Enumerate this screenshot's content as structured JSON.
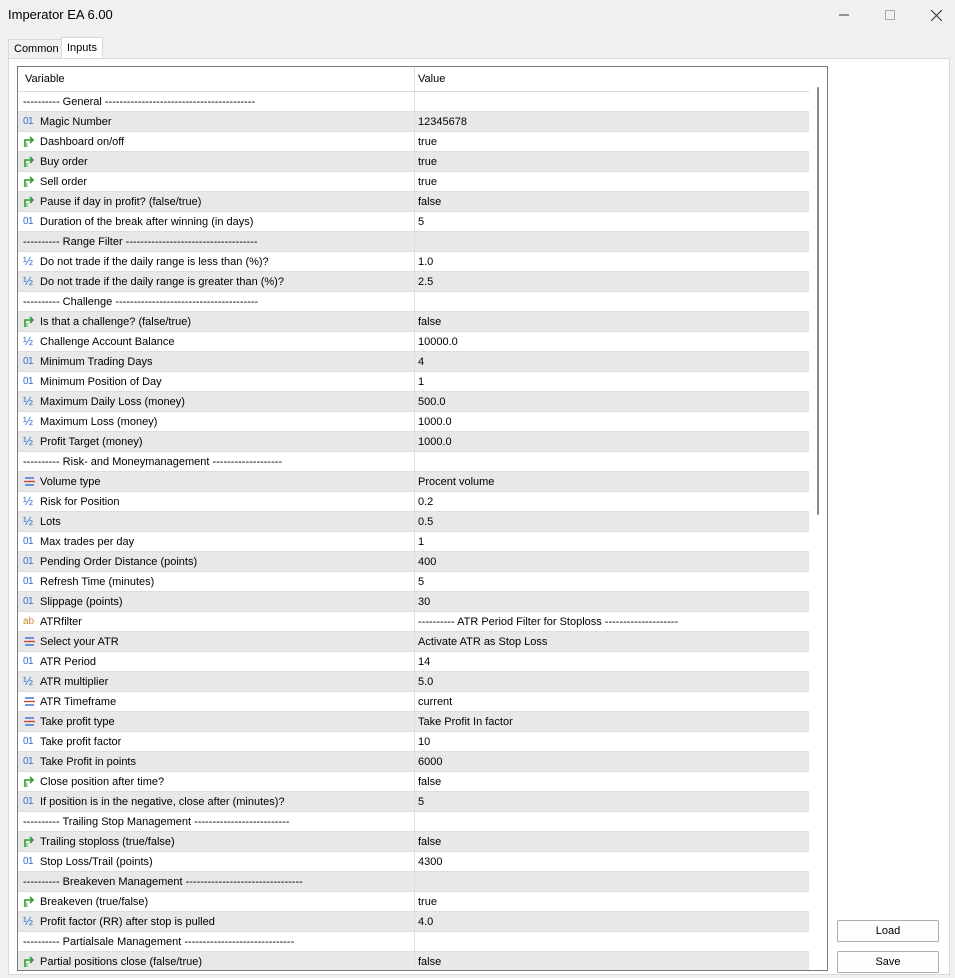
{
  "window": {
    "title": "Imperator EA 6.00"
  },
  "tabs": {
    "common": "Common",
    "inputs": "Inputs"
  },
  "table": {
    "col_variable": "Variable",
    "col_value": "Value"
  },
  "rows": [
    {
      "type": "section",
      "name": "---------- General -----------------------------------------",
      "value": ""
    },
    {
      "type": "int",
      "name": "Magic Number",
      "value": "12345678"
    },
    {
      "type": "bool",
      "name": "Dashboard on/off",
      "value": "true"
    },
    {
      "type": "bool",
      "name": "Buy order",
      "value": "true"
    },
    {
      "type": "bool",
      "name": "Sell order",
      "value": "true"
    },
    {
      "type": "bool",
      "name": "Pause if day in profit? (false/true)",
      "value": "false"
    },
    {
      "type": "int",
      "name": "Duration of the break after winning (in days)",
      "value": "5"
    },
    {
      "type": "section",
      "name": "---------- Range Filter ------------------------------------",
      "value": ""
    },
    {
      "type": "double",
      "name": "Do not trade  if the daily range is less than (%)?",
      "value": "1.0"
    },
    {
      "type": "double",
      "name": "Do not trade if the daily range is greater than (%)?",
      "value": "2.5"
    },
    {
      "type": "section",
      "name": "---------- Challenge ---------------------------------------",
      "value": ""
    },
    {
      "type": "bool",
      "name": "Is that a challenge? (false/true)",
      "value": "false"
    },
    {
      "type": "double",
      "name": "Challenge Account Balance",
      "value": "10000.0"
    },
    {
      "type": "int",
      "name": "Minimum Trading Days",
      "value": "4"
    },
    {
      "type": "int",
      "name": "Minimum Position of Day",
      "value": "1"
    },
    {
      "type": "double",
      "name": "Maximum Daily Loss (money)",
      "value": "500.0"
    },
    {
      "type": "double",
      "name": "Maximum Loss (money)",
      "value": "1000.0"
    },
    {
      "type": "double",
      "name": "Profit Target (money)",
      "value": "1000.0"
    },
    {
      "type": "section",
      "name": "---------- Risk- and Moneymanagement -------------------",
      "value": ""
    },
    {
      "type": "enum",
      "name": "Volume type",
      "value": "Procent volume"
    },
    {
      "type": "double",
      "name": "Risk for Position",
      "value": "0.2"
    },
    {
      "type": "double",
      "name": "Lots",
      "value": "0.5"
    },
    {
      "type": "int",
      "name": "Max trades per day",
      "value": "1"
    },
    {
      "type": "int",
      "name": "Pending Order Distance (points)",
      "value": "400"
    },
    {
      "type": "int",
      "name": "Refresh Time (minutes)",
      "value": "5"
    },
    {
      "type": "int",
      "name": "Slippage (points)",
      "value": "30"
    },
    {
      "type": "string",
      "name": "ATRfilter",
      "value": "---------- ATR Period Filter for Stoploss --------------------"
    },
    {
      "type": "enum",
      "name": "Select your ATR",
      "value": "Activate ATR as Stop Loss"
    },
    {
      "type": "int",
      "name": "ATR Period",
      "value": "14"
    },
    {
      "type": "double",
      "name": "ATR multiplier",
      "value": "5.0"
    },
    {
      "type": "enum",
      "name": "ATR Timeframe",
      "value": "current"
    },
    {
      "type": "enum",
      "name": "Take profit type",
      "value": "Take Profit In factor"
    },
    {
      "type": "int",
      "name": "Take profit factor",
      "value": "10"
    },
    {
      "type": "int",
      "name": "Take Profit in points",
      "value": "6000"
    },
    {
      "type": "bool",
      "name": "Close position after time?",
      "value": "false"
    },
    {
      "type": "int",
      "name": "If position is in the negative, close after (minutes)?",
      "value": "5"
    },
    {
      "type": "section",
      "name": "---------- Trailing Stop Management --------------------------",
      "value": ""
    },
    {
      "type": "bool",
      "name": "Trailing stoploss (true/false)",
      "value": "false"
    },
    {
      "type": "int",
      "name": "Stop Loss/Trail (points)",
      "value": "4300"
    },
    {
      "type": "section",
      "name": "---------- Breakeven Management --------------------------------",
      "value": ""
    },
    {
      "type": "bool",
      "name": "Breakeven (true/false)",
      "value": "true"
    },
    {
      "type": "double",
      "name": "Profit factor (RR) after stop is pulled",
      "value": "4.0"
    },
    {
      "type": "section",
      "name": "---------- Partialsale Management ------------------------------",
      "value": ""
    },
    {
      "type": "bool",
      "name": "Partial positions close (false/true)",
      "value": "false"
    }
  ],
  "icons": {
    "int": "01",
    "double": "½",
    "string": "ab",
    "bool": "bool-arrow-icon",
    "enum": "enum-list-icon"
  },
  "buttons": {
    "load": "Load",
    "save": "Save"
  }
}
